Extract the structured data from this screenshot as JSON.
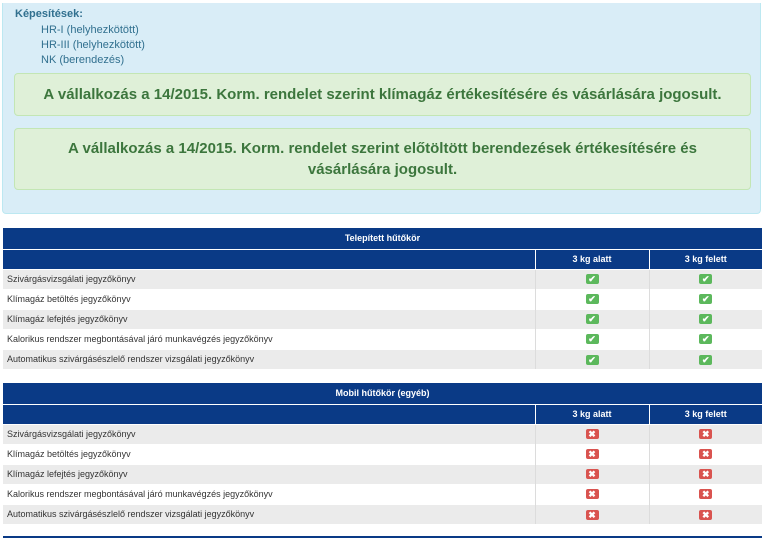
{
  "qualifications": {
    "title": "Képesítések:",
    "items": [
      "HR-I (helyhezkötött)",
      "HR-III (helyhezkötött)",
      "NK (berendezés)"
    ]
  },
  "alerts": [
    "A vállalkozás a 14/2015. Korm. rendelet szerint klímagáz értékesítésére és vásárlására jogosult.",
    "A vállalkozás a 14/2015. Korm. rendelet szerint előtöltött berendezések értékesítésére és vásárlására jogosult."
  ],
  "tables": [
    {
      "title": "Telepített hűtőkör",
      "col_below": "3 kg alatt",
      "col_above": "3 kg felett",
      "status": "ok",
      "rows": [
        "Szivárgásvizsgálati jegyzőkönyv",
        "Klímagáz betöltés jegyzőkönyv",
        "Klímagáz lefejtés jegyzőkönyv",
        "Kalorikus rendszer megbontásával járó munkavégzés jegyzőkönyv",
        "Automatikus szivárgásészlelő rendszer vizsgálati jegyzőkönyv"
      ]
    },
    {
      "title": "Mobil hűtőkör (egyéb)",
      "col_below": "3 kg alatt",
      "col_above": "3 kg felett",
      "status": "no",
      "rows": [
        "Szivárgásvizsgálati jegyzőkönyv",
        "Klímagáz betöltés jegyzőkönyv",
        "Klímagáz lefejtés jegyzőkönyv",
        "Kalorikus rendszer megbontásával járó munkavégzés jegyzőkönyv",
        "Automatikus szivárgásészlelő rendszer vizsgálati jegyzőkönyv"
      ]
    }
  ],
  "colors": {
    "header": "#0a3a86",
    "ok": "#5cb85c",
    "no": "#d9534f",
    "info_bg": "#d9edf7",
    "success_bg": "#dff0d8"
  },
  "icons": {
    "ok": "check-icon",
    "no": "cross-icon"
  }
}
